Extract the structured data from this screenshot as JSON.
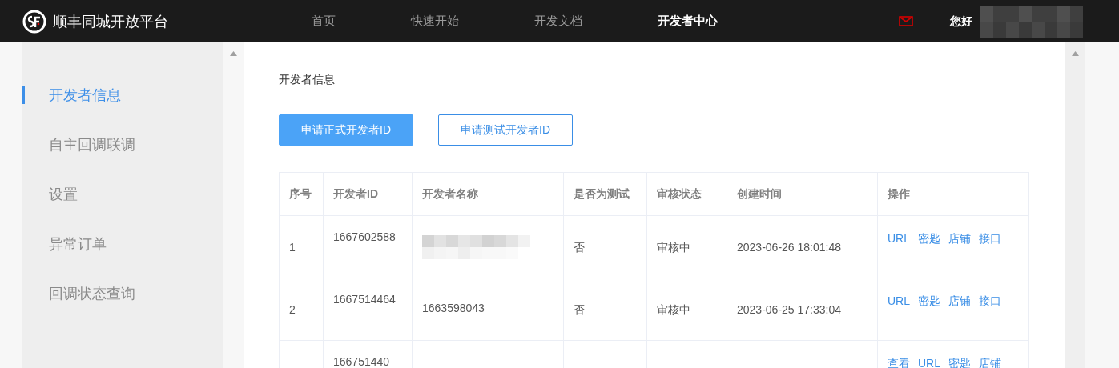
{
  "header": {
    "brand": "顺丰同城开放平台",
    "nav": [
      {
        "label": "首页",
        "selected": false
      },
      {
        "label": "快速开始",
        "selected": false
      },
      {
        "label": "开发文档",
        "selected": false
      },
      {
        "label": "开发者中心",
        "selected": true
      }
    ],
    "greeting": "您好"
  },
  "sidebar": {
    "items": [
      {
        "label": "开发者信息",
        "selected": true
      },
      {
        "label": "自主回调联调",
        "selected": false
      },
      {
        "label": "设置",
        "selected": false
      },
      {
        "label": "异常订单",
        "selected": false
      },
      {
        "label": "回调状态查询",
        "selected": false
      }
    ]
  },
  "content": {
    "title": "开发者信息",
    "buttons": [
      {
        "label": "申请正式开发者ID",
        "kind": "primary"
      },
      {
        "label": "申请测试开发者ID",
        "kind": "outline"
      }
    ],
    "table": {
      "columns": [
        "序号",
        "开发者ID",
        "开发者名称",
        "是否为测试",
        "审核状态",
        "创建时间",
        "操作"
      ],
      "rows": [
        {
          "cells": [
            "1",
            "1667602588",
            null,
            "否",
            "审核中",
            "2023-06-26 18:01:48"
          ],
          "actions": [
            "URL",
            "密匙",
            "店铺",
            "接口"
          ]
        },
        {
          "cells": [
            "2",
            "1667514464",
            "1663598043",
            "否",
            "审核中",
            "2023-06-25 17:33:04"
          ],
          "actions": [
            "URL",
            "密匙",
            "店铺",
            "接口"
          ]
        },
        {
          "cells": [
            null,
            "166751440",
            null,
            null,
            null,
            null
          ],
          "actions": [
            "查看",
            "URL",
            "密匙",
            "店铺"
          ]
        }
      ]
    }
  }
}
